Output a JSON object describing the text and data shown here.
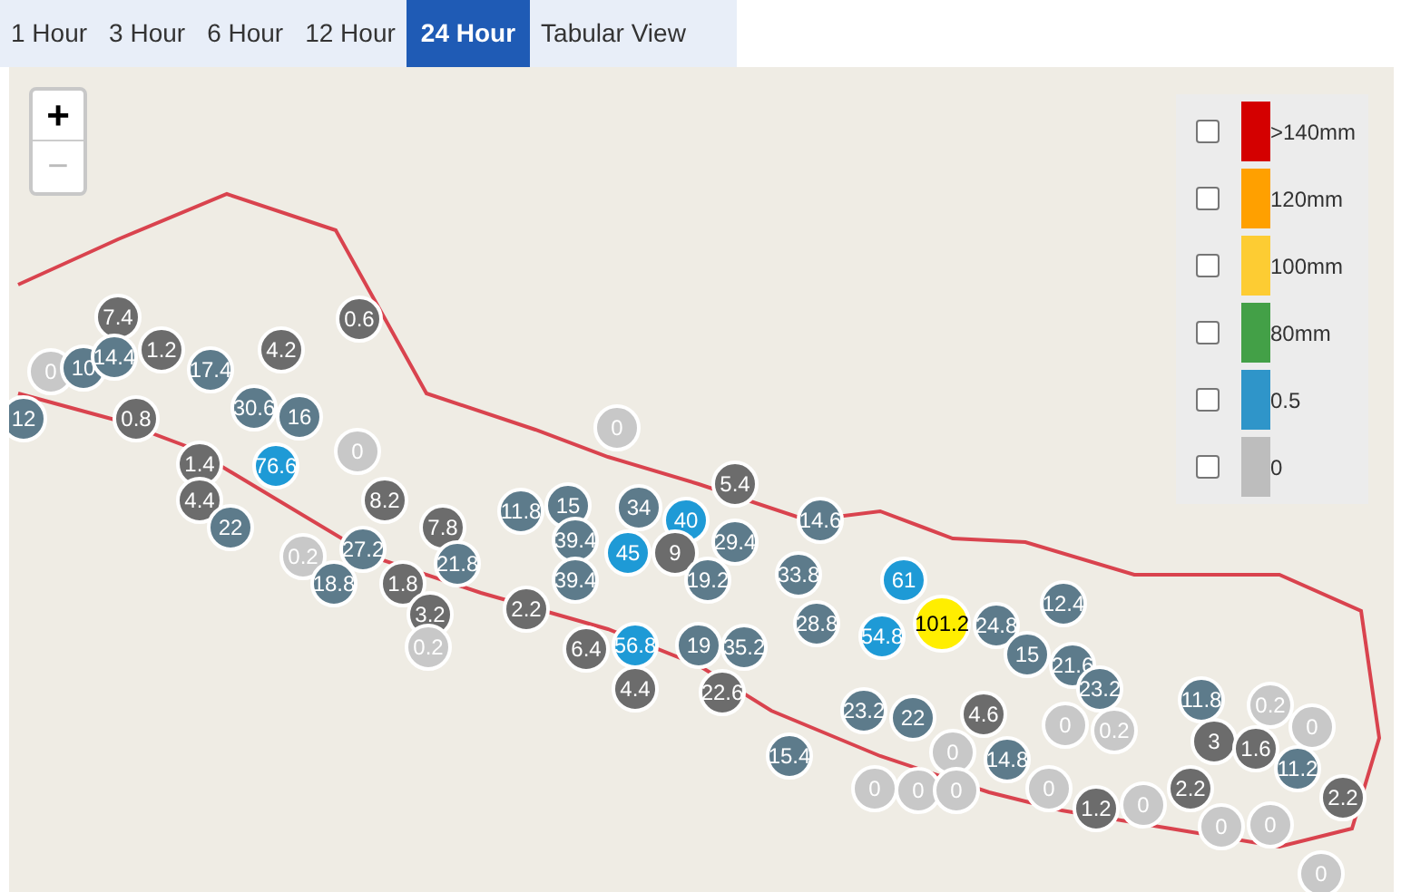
{
  "tabs": [
    {
      "label": "1 Hour",
      "selected": false
    },
    {
      "label": "3 Hour",
      "selected": false
    },
    {
      "label": "6 Hour",
      "selected": false
    },
    {
      "label": "12 Hour",
      "selected": false
    },
    {
      "label": "24 Hour",
      "selected": true
    },
    {
      "label": "Tabular View",
      "selected": false
    }
  ],
  "zoom": {
    "in": "+",
    "out": "−",
    "out_disabled": true
  },
  "legend": [
    {
      "label": ">140mm",
      "checked": false,
      "color": "#d40000"
    },
    {
      "label": "120mm",
      "checked": false,
      "color": "#ffa000"
    },
    {
      "label": "100mm",
      "checked": false,
      "color": "#fdcc33"
    },
    {
      "label": "80mm",
      "checked": false,
      "color": "#43a047"
    },
    {
      "label": "0.5",
      "checked": false,
      "color": "#2f95c9"
    },
    {
      "label": "0",
      "checked": false,
      "color": "#bdbdbd"
    }
  ],
  "markers": [
    {
      "value": "0",
      "color": "#c8c8c8"
    },
    {
      "value": "10",
      "color": "#5d7b8b"
    },
    {
      "value": "7.4",
      "color": "#6c6c6c"
    },
    {
      "value": "14.4",
      "color": "#5d7b8b"
    },
    {
      "value": "1.2",
      "color": "#6c6c6c"
    },
    {
      "value": "12",
      "color": "#5d7b8b"
    },
    {
      "value": "0.8",
      "color": "#6c6c6c"
    },
    {
      "value": "17.4",
      "color": "#5d7b8b"
    },
    {
      "value": "4.2",
      "color": "#6c6c6c"
    },
    {
      "value": "0.6",
      "color": "#6c6c6c"
    },
    {
      "value": "30.6",
      "color": "#5d7b8b"
    },
    {
      "value": "16",
      "color": "#5d7b8b"
    },
    {
      "value": "76.6",
      "color": "#1e9ad6"
    },
    {
      "value": "0",
      "color": "#c8c8c8"
    },
    {
      "value": "1.4",
      "color": "#6c6c6c"
    },
    {
      "value": "4.4",
      "color": "#6c6c6c"
    },
    {
      "value": "22",
      "color": "#5d7b8b"
    },
    {
      "value": "0.2",
      "color": "#c8c8c8"
    },
    {
      "value": "8.2",
      "color": "#6c6c6c"
    },
    {
      "value": "27.2",
      "color": "#5d7b8b"
    },
    {
      "value": "18.8",
      "color": "#5d7b8b"
    },
    {
      "value": "7.8",
      "color": "#6c6c6c"
    },
    {
      "value": "21.8",
      "color": "#5d7b8b"
    },
    {
      "value": "1.8",
      "color": "#6c6c6c"
    },
    {
      "value": "3.2",
      "color": "#6c6c6c"
    },
    {
      "value": "0.2",
      "color": "#c8c8c8"
    },
    {
      "value": "0",
      "color": "#c8c8c8"
    },
    {
      "value": "11.8",
      "color": "#5d7b8b"
    },
    {
      "value": "15",
      "color": "#5d7b8b"
    },
    {
      "value": "39.4",
      "color": "#5d7b8b"
    },
    {
      "value": "39.4",
      "color": "#5d7b8b"
    },
    {
      "value": "2.2",
      "color": "#6c6c6c"
    },
    {
      "value": "34",
      "color": "#5d7b8b"
    },
    {
      "value": "40",
      "color": "#1e9ad6"
    },
    {
      "value": "45",
      "color": "#1e9ad6"
    },
    {
      "value": "9",
      "color": "#6c6c6c"
    },
    {
      "value": "5.4",
      "color": "#6c6c6c"
    },
    {
      "value": "29.4",
      "color": "#5d7b8b"
    },
    {
      "value": "19.2",
      "color": "#5d7b8b"
    },
    {
      "value": "14.6",
      "color": "#5d7b8b"
    },
    {
      "value": "33.8",
      "color": "#5d7b8b"
    },
    {
      "value": "6.4",
      "color": "#6c6c6c"
    },
    {
      "value": "56.8",
      "color": "#1e9ad6"
    },
    {
      "value": "4.4",
      "color": "#6c6c6c"
    },
    {
      "value": "19",
      "color": "#5d7b8b"
    },
    {
      "value": "22.6",
      "color": "#6c6c6c"
    },
    {
      "value": "35.2",
      "color": "#5d7b8b"
    },
    {
      "value": "28.8",
      "color": "#5d7b8b"
    },
    {
      "value": "61",
      "color": "#1e9ad6"
    },
    {
      "value": "54.8",
      "color": "#1e9ad6"
    },
    {
      "value": "101.2",
      "color": "#ffee00"
    },
    {
      "value": "24.8",
      "color": "#5d7b8b"
    },
    {
      "value": "12.4",
      "color": "#5d7b8b"
    },
    {
      "value": "15",
      "color": "#5d7b8b"
    },
    {
      "value": "21.6",
      "color": "#5d7b8b"
    },
    {
      "value": "23.2",
      "color": "#5d7b8b"
    },
    {
      "value": "23.2",
      "color": "#5d7b8b"
    },
    {
      "value": "22",
      "color": "#5d7b8b"
    },
    {
      "value": "4.6",
      "color": "#6c6c6c"
    },
    {
      "value": "0",
      "color": "#c8c8c8"
    },
    {
      "value": "0.2",
      "color": "#c8c8c8"
    },
    {
      "value": "15.4",
      "color": "#5d7b8b"
    },
    {
      "value": "14.8",
      "color": "#5d7b8b"
    },
    {
      "value": "0",
      "color": "#c8c8c8"
    },
    {
      "value": "0",
      "color": "#c8c8c8"
    },
    {
      "value": "0",
      "color": "#c8c8c8"
    },
    {
      "value": "0",
      "color": "#c8c8c8"
    },
    {
      "value": "1.2",
      "color": "#6c6c6c"
    },
    {
      "value": "0",
      "color": "#c8c8c8"
    },
    {
      "value": "0",
      "color": "#c8c8c8"
    },
    {
      "value": "11.8",
      "color": "#5d7b8b"
    },
    {
      "value": "0.2",
      "color": "#c8c8c8"
    },
    {
      "value": "3",
      "color": "#6c6c6c"
    },
    {
      "value": "1.6",
      "color": "#6c6c6c"
    },
    {
      "value": "0",
      "color": "#c8c8c8"
    },
    {
      "value": "2.2",
      "color": "#6c6c6c"
    },
    {
      "value": "11.2",
      "color": "#5d7b8b"
    },
    {
      "value": "2.2",
      "color": "#6c6c6c"
    },
    {
      "value": "0",
      "color": "#c8c8c8"
    },
    {
      "value": "0",
      "color": "#c8c8c8"
    },
    {
      "value": "0",
      "color": "#c8c8c8"
    }
  ]
}
